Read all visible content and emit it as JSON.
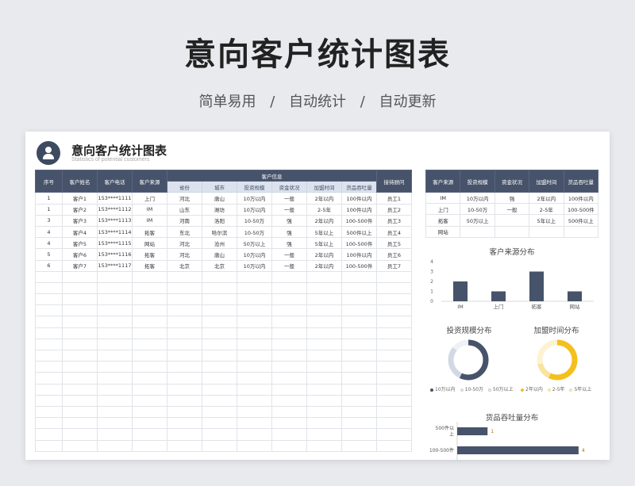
{
  "hero": {
    "title": "意向客户统计图表",
    "subtitle": [
      "简单易用",
      "/",
      "自动统计",
      "/",
      "自动更新"
    ]
  },
  "sheet": {
    "title": "意向客户统计图表",
    "subtitle": "Statistics of potential customers",
    "avatar_icon": "user-icon"
  },
  "main_table": {
    "group_header": "客户信息",
    "headers_left": [
      "序号",
      "客户姓名",
      "客户电话",
      "客户来源"
    ],
    "headers_sub": [
      "省份",
      "城市",
      "投资规模",
      "资金状况",
      "加盟时间",
      "货品吞吐量"
    ],
    "header_right": "接待顾问",
    "rows": [
      [
        "1",
        "客户1",
        "153****1111",
        "上门",
        "河北",
        "唐山",
        "10万以内",
        "一般",
        "2年以内",
        "100件以内",
        "员工1"
      ],
      [
        "1",
        "客户2",
        "153****1112",
        "IM",
        "山东",
        "潍坊",
        "10万以内",
        "一般",
        "2-5年",
        "100件以内",
        "员工2"
      ],
      [
        "3",
        "客户3",
        "153****1113",
        "IM",
        "河南",
        "洛阳",
        "10-50万",
        "强",
        "2年以内",
        "100-500件",
        "员工3"
      ],
      [
        "4",
        "客户4",
        "153****1114",
        "拓客",
        "东北",
        "哈尔滨",
        "10-50万",
        "强",
        "5年以上",
        "500件以上",
        "员工4"
      ],
      [
        "4",
        "客户5",
        "153****1115",
        "网站",
        "河北",
        "沧州",
        "50万以上",
        "强",
        "5年以上",
        "100-500件",
        "员工5"
      ],
      [
        "5",
        "客户6",
        "153****1116",
        "拓客",
        "河北",
        "唐山",
        "10万以内",
        "一般",
        "2年以内",
        "100件以内",
        "员工6"
      ],
      [
        "6",
        "客户7",
        "153****1117",
        "拓客",
        "北京",
        "北京",
        "10万以内",
        "一般",
        "2年以内",
        "100-500件",
        "员工7"
      ]
    ],
    "empty_rows": 16
  },
  "side_table": {
    "headers": [
      "客户来源",
      "投资规模",
      "资金状况",
      "加盟时间",
      "货品吞吐量"
    ],
    "rows": [
      [
        "IM",
        "10万以内",
        "强",
        "2年以内",
        "100件以内"
      ],
      [
        "上门",
        "10-50万",
        "一般",
        "2-5年",
        "100-500件"
      ],
      [
        "拓客",
        "50万以上",
        "",
        "5年以上",
        "500件以上"
      ],
      [
        "网站",
        "",
        "",
        "",
        ""
      ]
    ]
  },
  "chart_data": [
    {
      "type": "bar",
      "title": "客户来源分布",
      "categories": [
        "IM",
        "上门",
        "拓客",
        "网站"
      ],
      "values": [
        2,
        1,
        3,
        1
      ],
      "ylim": [
        0,
        4
      ],
      "yticks": [
        "0",
        "1",
        "2",
        "3",
        "4"
      ],
      "color": "#46536a"
    },
    {
      "type": "pie",
      "title": "投资规模分布",
      "categories": [
        "10万以内",
        "10-50万",
        "50万以上"
      ],
      "values": [
        4,
        2,
        1
      ],
      "colors": [
        "#46536a",
        "#d2d9e4",
        "#eef1f5"
      ]
    },
    {
      "type": "pie",
      "title": "加盟时间分布",
      "categories": [
        "2年以内",
        "2-5年",
        "5年以上"
      ],
      "values": [
        4,
        1,
        2
      ],
      "colors": [
        "#f4c01e",
        "#f8e4a0",
        "#fdf3d2"
      ]
    },
    {
      "type": "bar",
      "title": "货品吞吐量分布",
      "categories": [
        "500件以上",
        "100-500件"
      ],
      "category_lines": [
        [
          "500件以",
          "上"
        ],
        [
          "100-500件"
        ]
      ],
      "values": [
        1,
        4
      ],
      "value_labels": [
        "1",
        "4"
      ],
      "xlim": [
        0,
        4.5
      ],
      "color": "#46536a"
    }
  ]
}
